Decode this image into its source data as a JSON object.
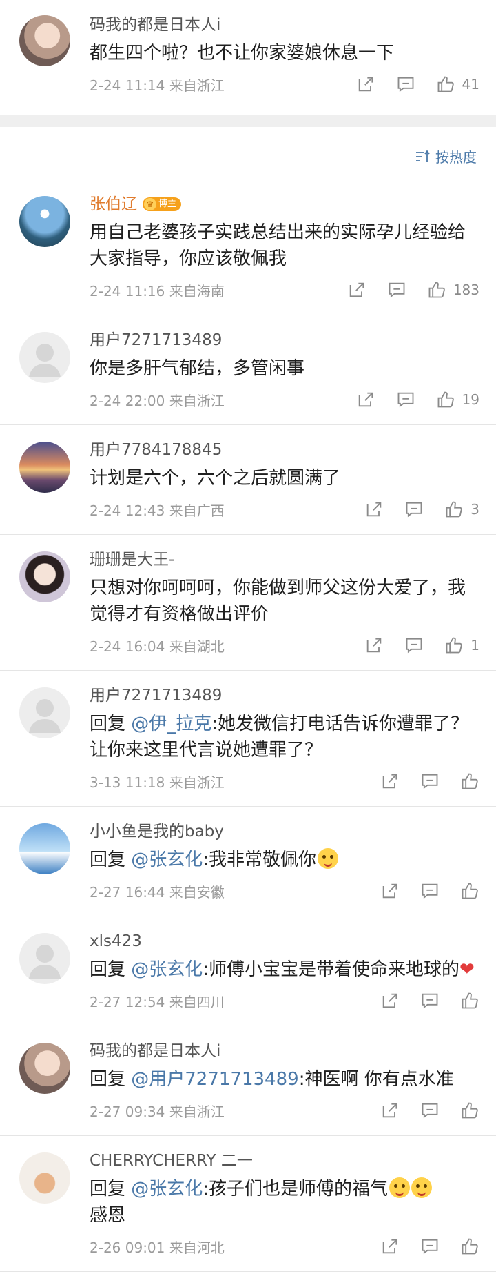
{
  "top_comment": {
    "name": "码我的都是日本人i",
    "text": "都生四个啦？也不让你家婆娘休息一下",
    "meta": "2-24 11:14  来自浙江",
    "likes": "41"
  },
  "sort": {
    "label": "按热度"
  },
  "comments": [
    {
      "name": "张伯辽",
      "badge": "博主",
      "text": "用自己老婆孩子实践总结出来的实际孕儿经验给大家指导，你应该敬佩我",
      "meta": "2-24 11:16  来自海南",
      "likes": "183"
    },
    {
      "name": "用户7271713489",
      "text": "你是多肝气郁结，多管闲事",
      "meta": "2-24 22:00  来自浙江",
      "likes": "19"
    },
    {
      "name": "用户7784178845",
      "text": "计划是六个，六个之后就圆满了",
      "meta": "2-24 12:43  来自广西",
      "likes": "3"
    },
    {
      "name": "珊珊是大王-",
      "text": "只想对你呵呵呵，你能做到师父这份大爱了，我觉得才有资格做出评价",
      "meta": "2-24 16:04  来自湖北",
      "likes": "1"
    },
    {
      "name": "用户7271713489",
      "reply_prefix": "回复 ",
      "mention": "@伊_拉克",
      "text": ":她发微信打电话告诉你遭罪了？让你来这里代言说她遭罪了？",
      "meta": "3-13 11:18  来自浙江",
      "likes": ""
    },
    {
      "name": "小小鱼是我的baby",
      "reply_prefix": "回复 ",
      "mention": "@张玄化",
      "text": ":我非常敬佩你",
      "meta": "2-27 16:44  来自安徽",
      "likes": ""
    },
    {
      "name": "xls423",
      "reply_prefix": "回复 ",
      "mention": "@张玄化",
      "text": ":师傅小宝宝是带着使命来地球的",
      "meta": "2-27 12:54  来自四川",
      "likes": ""
    },
    {
      "name": "码我的都是日本人i",
      "reply_prefix": "回复 ",
      "mention": "@用户7271713489",
      "text": ":神医啊 你有点水准",
      "meta": "2-27 09:34  来自浙江",
      "likes": ""
    },
    {
      "name": "CHERRYCHERRY 二一",
      "reply_prefix": "回复 ",
      "mention": "@张玄化",
      "text": ":孩子们也是师傅的福气",
      "text2": "感恩",
      "meta": "2-26 09:01  来自河北",
      "likes": ""
    }
  ],
  "heart_glyph": "❤"
}
